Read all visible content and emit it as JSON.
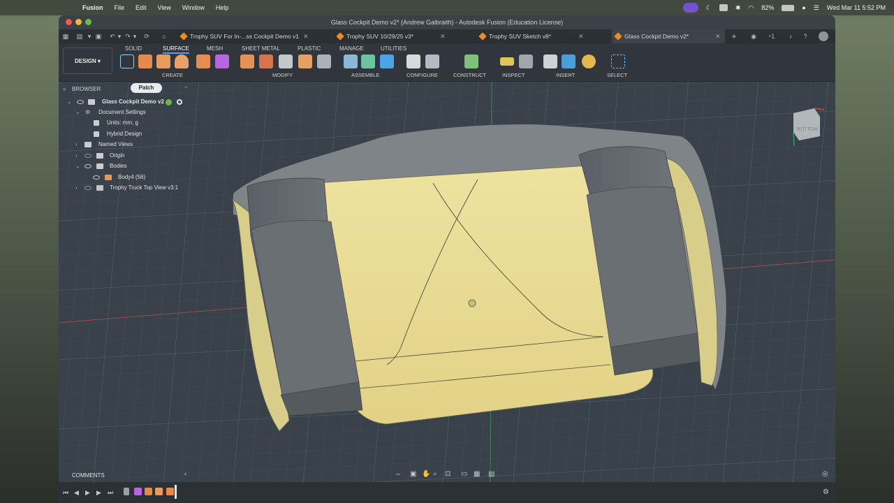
{
  "menubar": {
    "app_name": "Fusion",
    "menus": [
      "File",
      "Edit",
      "View",
      "Window",
      "Help"
    ],
    "battery": "82%",
    "clock": "Wed Mar 11  5:52 PM"
  },
  "window": {
    "title": "Glass Cockpit Demo v2* (Andrew Galbraith) - Autodesk Fusion (Education License)"
  },
  "tabs": [
    {
      "label": "Trophy SUV For In-...ss Cockpit Demo v1",
      "active": false
    },
    {
      "label": "Trophy SUV 10/29/25 v3*",
      "active": false
    },
    {
      "label": "Trophy SUV Sketch v8*",
      "active": false
    },
    {
      "label": "Glass Cockpit Demo v2*",
      "active": true
    }
  ],
  "notifications_count": "1",
  "toolbar": {
    "workspace_button": "DESIGN",
    "workspace_tabs": [
      "SOLID",
      "SURFACE",
      "MESH",
      "SHEET METAL",
      "PLASTIC",
      "MANAGE",
      "UTILITIES"
    ],
    "active_workspace_tab": "SURFACE",
    "groups": [
      "CREATE",
      "MODIFY",
      "ASSEMBLE",
      "CONFIGURE",
      "CONSTRUCT",
      "INSPECT",
      "INSERT",
      "SELECT"
    ]
  },
  "browser": {
    "header": "BROWSER",
    "active_command": "Patch",
    "root": "Glass Cockpit Demo v2",
    "items": [
      {
        "label": "Document Settings"
      },
      {
        "label": "Units: mm, g"
      },
      {
        "label": "Hybrid Design"
      },
      {
        "label": "Named Views"
      },
      {
        "label": "Origin"
      },
      {
        "label": "Bodies"
      },
      {
        "label": "Body4 (56)"
      },
      {
        "label": "Trophy Truck Top View v3:1"
      }
    ]
  },
  "viewcube": {
    "face_label": "BOTTOM"
  },
  "bottom": {
    "comments_label": "COMMENTS"
  },
  "colors": {
    "viewport_bg": "#39424b",
    "surface_fill": "#e8dc95",
    "active_tab_underline": "#4da3ff",
    "accent_orange": "#f08a24"
  }
}
